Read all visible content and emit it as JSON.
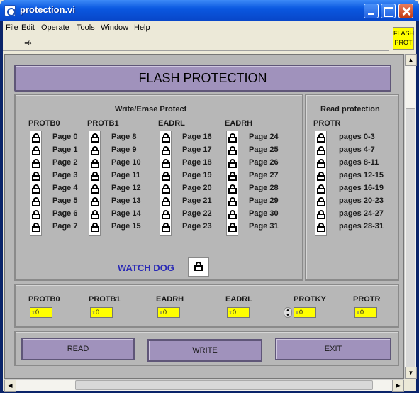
{
  "window": {
    "title": "protection.vi"
  },
  "menu": [
    "File",
    "Edit",
    "Operate",
    "Tools",
    "Window",
    "Help"
  ],
  "badge": {
    "line1": "FLASH",
    "line2": "PROT"
  },
  "header": {
    "title": "FLASH PROTECTION"
  },
  "write_erase": {
    "title": "Write/Erase Protect",
    "columns": [
      {
        "name": "PROTB0",
        "pages": [
          "Page 0",
          "Page 1",
          "Page 2",
          "Page 3",
          "Page 4",
          "Page 5",
          "Page 6",
          "Page 7"
        ]
      },
      {
        "name": "PROTB1",
        "pages": [
          "Page 8",
          "Page 9",
          "Page 10",
          "Page 11",
          "Page 12",
          "Page 13",
          "Page 14",
          "Page 15"
        ]
      },
      {
        "name": "EADRL",
        "pages": [
          "Page 16",
          "Page 17",
          "Page 18",
          "Page 19",
          "Page 20",
          "Page 21",
          "Page 22",
          "Page 23"
        ]
      },
      {
        "name": "EADRH",
        "pages": [
          "Page 24",
          "Page 25",
          "Page 26",
          "Page 27",
          "Page 28",
          "Page 29",
          "Page 30",
          "Page 31"
        ]
      }
    ]
  },
  "read_protect": {
    "title": "Read protection",
    "column": "PROTR",
    "pages": [
      "pages 0-3",
      "pages 4-7",
      "pages 8-11",
      "pages 12-15",
      "pages 16-19",
      "pages 20-23",
      "pages 24-27",
      "pages 28-31"
    ]
  },
  "watchdog": {
    "label": "WATCH DOG"
  },
  "registers": [
    {
      "name": "PROTB0",
      "value": "0"
    },
    {
      "name": "PROTB1",
      "value": "0"
    },
    {
      "name": "EADRH",
      "value": "0"
    },
    {
      "name": "EADRL",
      "value": "0"
    },
    {
      "name": "PROTKY",
      "value": "0"
    },
    {
      "name": "PROTR",
      "value": "0"
    }
  ],
  "buttons": {
    "read": "READ",
    "write": "WRITE",
    "exit": "EXIT"
  },
  "icons": {
    "lock": "lock-icon",
    "run": "run-arrow-icon"
  },
  "colors": {
    "header": "#a092bc",
    "panel": "#b7b7b7",
    "register": "#ffff00",
    "watchdog_text": "#2a2ab6"
  }
}
